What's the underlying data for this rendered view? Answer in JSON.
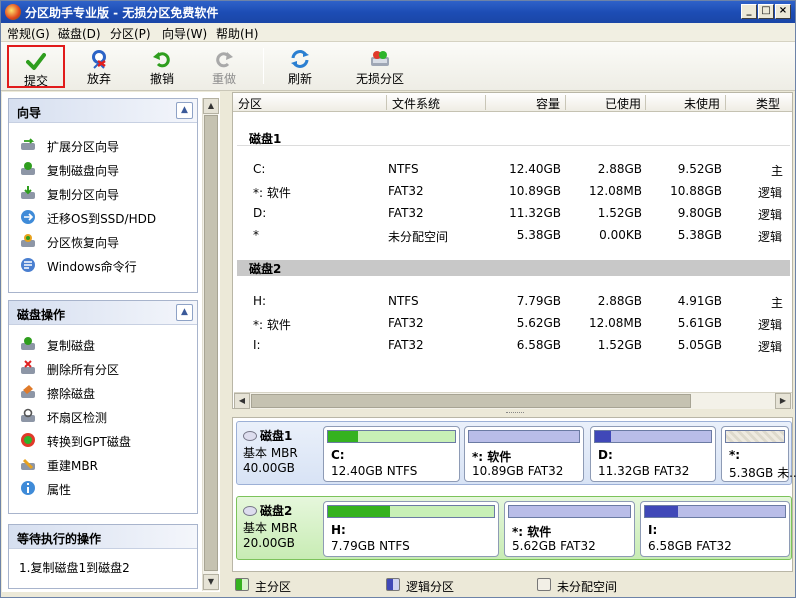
{
  "window": {
    "title": "分区助手专业版 - 无损分区免费软件",
    "controls": {
      "minimize": "_",
      "maximize": "□",
      "close": "×"
    }
  },
  "menu": [
    "常规(G)",
    "磁盘(D)",
    "分区(P)",
    "向导(W)",
    "帮助(H)"
  ],
  "toolbar": {
    "submit": "提交",
    "discard": "放弃",
    "undo": "撤销",
    "redo": "重做",
    "refresh": "刷新",
    "lossless": "无损分区"
  },
  "wizard": {
    "title": "向导",
    "items": [
      "扩展分区向导",
      "复制磁盘向导",
      "复制分区向导",
      "迁移OS到SSD/HDD",
      "分区恢复向导",
      "Windows命令行"
    ]
  },
  "diskops": {
    "title": "磁盘操作",
    "items": [
      "复制磁盘",
      "删除所有分区",
      "擦除磁盘",
      "坏扇区检测",
      "转换到GPT磁盘",
      "重建MBR",
      "属性"
    ]
  },
  "pending": {
    "title": "等待执行的操作",
    "items": [
      "1.复制磁盘1到磁盘2"
    ]
  },
  "table": {
    "columns": [
      "分区",
      "文件系统",
      "容量",
      "已使用",
      "未使用",
      "类型"
    ],
    "disks": [
      {
        "name": "磁盘1",
        "rows": [
          {
            "part": "C:",
            "fs": "NTFS",
            "cap": "12.40GB",
            "used": "2.88GB",
            "free": "9.52GB",
            "type": "主"
          },
          {
            "part": "*: 软件",
            "fs": "FAT32",
            "cap": "10.89GB",
            "used": "12.08MB",
            "free": "10.88GB",
            "type": "逻辑"
          },
          {
            "part": "D:",
            "fs": "FAT32",
            "cap": "11.32GB",
            "used": "1.52GB",
            "free": "9.80GB",
            "type": "逻辑"
          },
          {
            "part": "*",
            "fs": "未分配空间",
            "cap": "5.38GB",
            "used": "0.00KB",
            "free": "5.38GB",
            "type": "逻辑"
          }
        ]
      },
      {
        "name": "磁盘2",
        "rows": [
          {
            "part": "H:",
            "fs": "NTFS",
            "cap": "7.79GB",
            "used": "2.88GB",
            "free": "4.91GB",
            "type": "主"
          },
          {
            "part": "*: 软件",
            "fs": "FAT32",
            "cap": "5.62GB",
            "used": "12.08MB",
            "free": "5.61GB",
            "type": "逻辑"
          },
          {
            "part": "I:",
            "fs": "FAT32",
            "cap": "6.58GB",
            "used": "1.52GB",
            "free": "5.05GB",
            "type": "逻辑"
          }
        ]
      }
    ]
  },
  "diskmap": [
    {
      "name": "磁盘1",
      "kind": "基本 MBR",
      "size": "40.00GB",
      "parts": [
        {
          "name": "C:",
          "desc": "12.40GB NTFS",
          "type": "primary",
          "usage": 0.23
        },
        {
          "name": "*: 软件",
          "desc": "10.89GB FAT32",
          "type": "logical",
          "usage": 0.0
        },
        {
          "name": "D:",
          "desc": "11.32GB FAT32",
          "type": "logical",
          "usage": 0.13
        },
        {
          "name": "*:",
          "desc": "5.38GB 未...",
          "type": "unallocated",
          "usage": 0.0
        }
      ]
    },
    {
      "name": "磁盘2",
      "kind": "基本 MBR",
      "size": "20.00GB",
      "parts": [
        {
          "name": "H:",
          "desc": "7.79GB NTFS",
          "type": "primary",
          "usage": 0.37
        },
        {
          "name": "*: 软件",
          "desc": "5.62GB FAT32",
          "type": "logical",
          "usage": 0.0
        },
        {
          "name": "I:",
          "desc": "6.58GB FAT32",
          "type": "logical",
          "usage": 0.23
        }
      ]
    }
  ],
  "legend": {
    "primary": "主分区",
    "logical": "逻辑分区",
    "unallocated": "未分配空间"
  },
  "colors": {
    "primary": "#35b21f",
    "logical": "#4048b8",
    "unallocated": "#e8e4d6",
    "accent": "#e11b1b"
  }
}
